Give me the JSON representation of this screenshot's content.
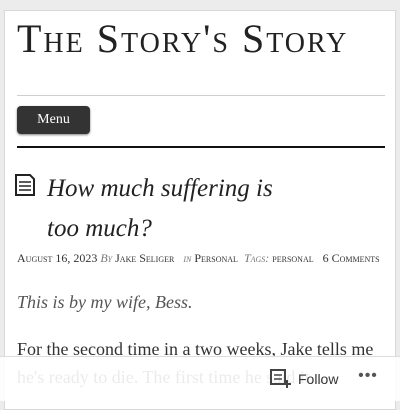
{
  "site": {
    "title": "The Story's Story"
  },
  "nav": {
    "menu_label": "Menu"
  },
  "post": {
    "title_line1": "How much suffering is",
    "title_line2": "too much?",
    "date": "August 16, 2023",
    "by_label": "By",
    "author": "Jake Seliger",
    "in_label": "in",
    "category": "Personal",
    "tags_label": "Tags:",
    "tag": "personal",
    "comments": "6 Comments",
    "lead": "This is by my wife, Bess.",
    "body": "For the second time in a two weeks, Jake tells me he's ready to die. The first time he said it..."
  },
  "follow_bar": {
    "follow_label": "Follow",
    "more_label": "•••"
  }
}
